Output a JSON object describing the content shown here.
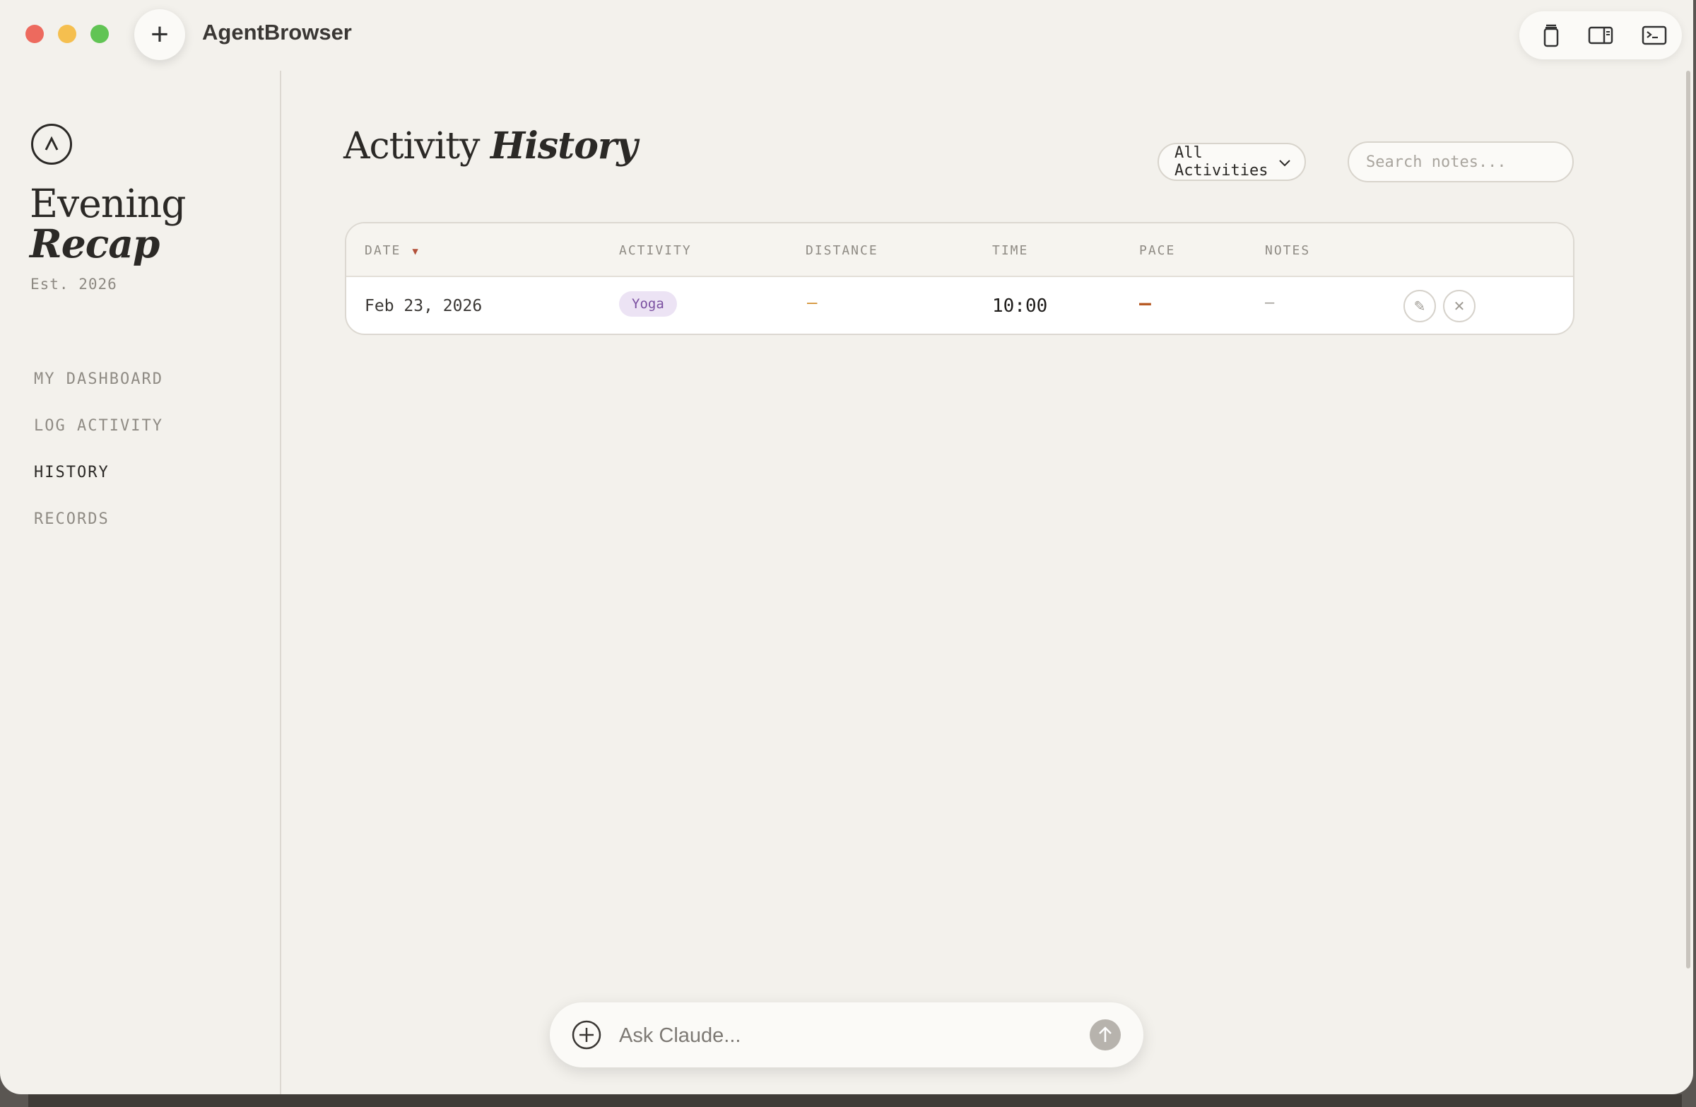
{
  "window": {
    "title": "AgentBrowser"
  },
  "toolbar": {
    "icons": [
      "clipboard-icon",
      "sidebar-icon",
      "terminal-icon"
    ]
  },
  "sidebar": {
    "brand_line1": "Evening",
    "brand_line2": "Recap",
    "established": "Est. 2026",
    "items": [
      {
        "label": "MY DASHBOARD",
        "active": false
      },
      {
        "label": "LOG ACTIVITY",
        "active": false
      },
      {
        "label": "HISTORY",
        "active": true
      },
      {
        "label": "RECORDS",
        "active": false
      }
    ]
  },
  "main": {
    "title_regular": "Activity",
    "title_italic": "History",
    "filter": {
      "selected": "All Activities"
    },
    "search": {
      "placeholder": "Search notes..."
    },
    "table": {
      "columns": [
        "DATE",
        "ACTIVITY",
        "DISTANCE",
        "TIME",
        "PACE",
        "NOTES"
      ],
      "sort_indicator": "▼",
      "rows": [
        {
          "date": "Feb 23, 2026",
          "activity": "Yoga",
          "distance": "—",
          "time": "10:00",
          "pace": "—",
          "notes": "—"
        }
      ]
    }
  },
  "assistant": {
    "placeholder": "Ask Claude..."
  },
  "colors": {
    "background": "#f3f1ec",
    "accent": "#b3513a",
    "pill_bg": "#ece3f4",
    "pill_text": "#7a4fa0"
  }
}
